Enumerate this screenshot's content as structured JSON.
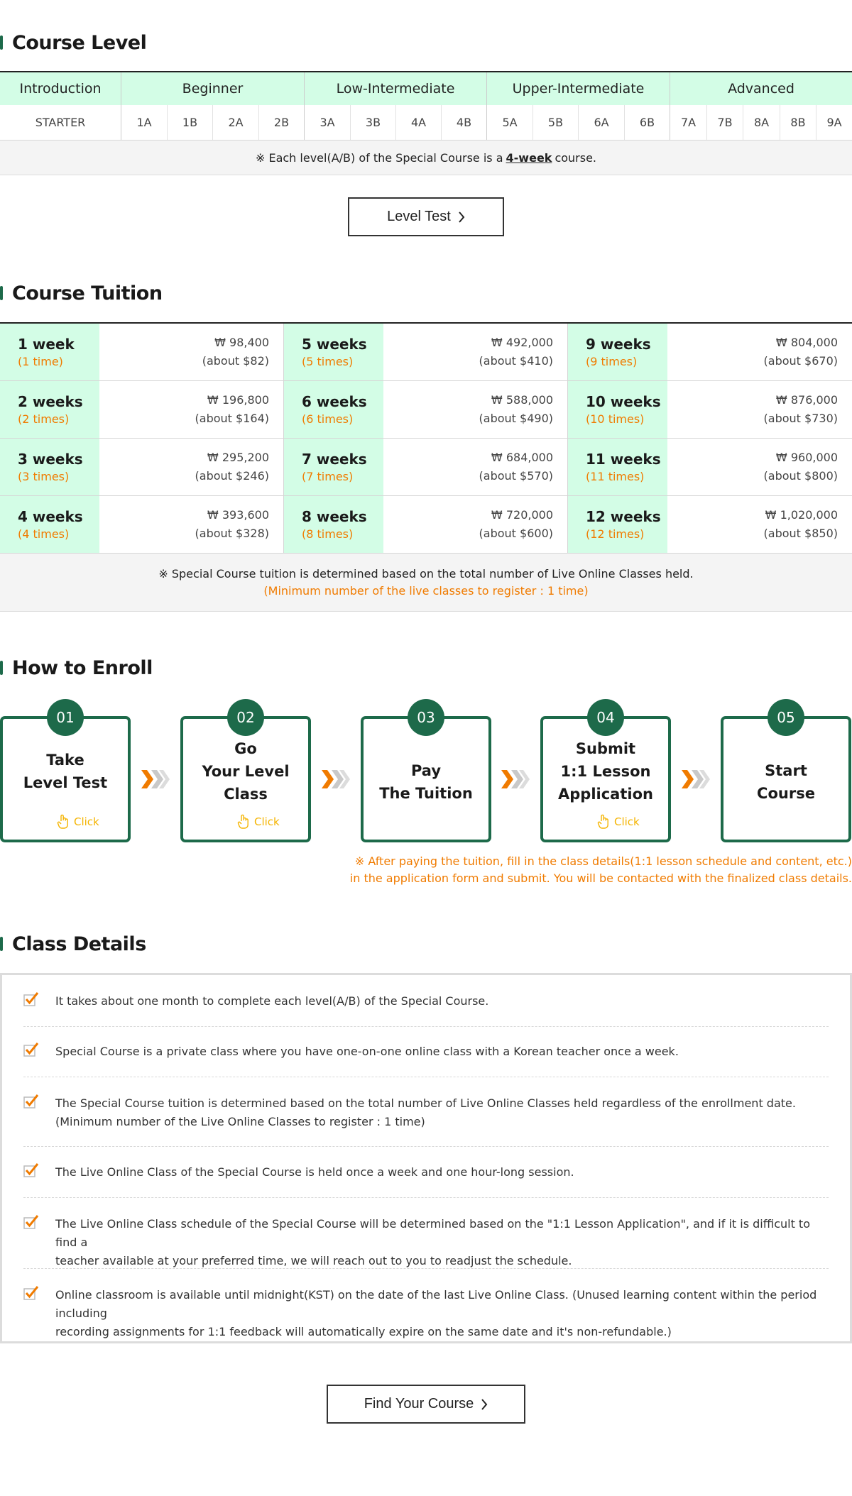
{
  "course_level": {
    "title": "Course Level",
    "groups": [
      "Introduction",
      "Beginner",
      "Low-Intermediate",
      "Upper-Intermediate",
      "Advanced"
    ],
    "levels": [
      "STARTER",
      "1A",
      "1B",
      "2A",
      "2B",
      "3A",
      "3B",
      "4A",
      "4B",
      "5A",
      "5B",
      "6A",
      "6B",
      "7A",
      "7B",
      "8A",
      "8B",
      "9A"
    ],
    "note_prefix": "※ Each level(A/B) of the Special Course is a",
    "note_emphasis": "4-week",
    "note_suffix": "course.",
    "level_test_button": "Level Test"
  },
  "course_tuition": {
    "title": "Course Tuition",
    "rows": [
      [
        {
          "weeks": "1 week",
          "times": "(1 time)",
          "price": "₩ 98,400",
          "usd": "(about $82)"
        },
        {
          "weeks": "5 weeks",
          "times": "(5 times)",
          "price": "₩ 492,000",
          "usd": "(about $410)"
        },
        {
          "weeks": "9 weeks",
          "times": "(9 times)",
          "price": "₩ 804,000",
          "usd": "(about $670)"
        }
      ],
      [
        {
          "weeks": "2 weeks",
          "times": "(2 times)",
          "price": "₩ 196,800",
          "usd": "(about $164)"
        },
        {
          "weeks": "6 weeks",
          "times": "(6 times)",
          "price": "₩ 588,000",
          "usd": "(about $490)"
        },
        {
          "weeks": "10 weeks",
          "times": "(10 times)",
          "price": "₩ 876,000",
          "usd": "(about $730)"
        }
      ],
      [
        {
          "weeks": "3 weeks",
          "times": "(3 times)",
          "price": "₩ 295,200",
          "usd": "(about $246)"
        },
        {
          "weeks": "7 weeks",
          "times": "(7 times)",
          "price": "₩ 684,000",
          "usd": "(about $570)"
        },
        {
          "weeks": "11 weeks",
          "times": "(11 times)",
          "price": "₩ 960,000",
          "usd": "(about $800)"
        }
      ],
      [
        {
          "weeks": "4 weeks",
          "times": "(4 times)",
          "price": "₩ 393,600",
          "usd": "(about $328)"
        },
        {
          "weeks": "8 weeks",
          "times": "(8 times)",
          "price": "₩ 720,000",
          "usd": "(about $600)"
        },
        {
          "weeks": "12 weeks",
          "times": "(12 times)",
          "price": "₩ 1,020,000",
          "usd": "(about $850)"
        }
      ]
    ],
    "note_line1": "※ Special Course tuition is determined based on the total number of Live Online Classes held.",
    "note_line2": "(Minimum number of the live classes to register : 1 time)"
  },
  "how_to_enroll": {
    "title": "How to Enroll",
    "steps": [
      {
        "num": "01",
        "line1": "Take",
        "line2": "Level Test",
        "line3": "",
        "click": "Click"
      },
      {
        "num": "02",
        "line1": "Go",
        "line2": "Your Level Class",
        "line3": "",
        "click": "Click"
      },
      {
        "num": "03",
        "line1": "Pay",
        "line2": "The Tuition",
        "line3": "",
        "click": ""
      },
      {
        "num": "04",
        "line1": "Submit",
        "line2": "1:1 Lesson",
        "line3": "Application",
        "click": "Click"
      },
      {
        "num": "05",
        "line1": "Start",
        "line2": "Course",
        "line3": "",
        "click": ""
      }
    ],
    "note_line1": "※ After paying the tuition, fill in the class details(1:1 lesson schedule and content, etc.)",
    "note_line2": "in the application form and submit. You will be contacted with the finalized class details."
  },
  "class_details": {
    "title": "Class Details",
    "items": [
      {
        "line1": "It takes about one month to complete each level(A/B) of the Special Course.",
        "line2": ""
      },
      {
        "line1": "Special Course is a private class where you have one-on-one online class with a Korean teacher once a week.",
        "line2": ""
      },
      {
        "line1": "The Special Course tuition is determined based on the total number of Live Online Classes held regardless of the enrollment date.",
        "line2": "(Minimum number of the Live Online Classes to register : 1 time)"
      },
      {
        "line1": "The Live Online Class of the Special Course is held once a week and one hour-long session.",
        "line2": ""
      },
      {
        "line1": "The Live Online Class schedule of the Special Course will be determined based on the \"1:1 Lesson Application\", and if it is difficult to find a",
        "line2": "teacher available at your preferred time, we will reach out to you to readjust the schedule."
      },
      {
        "line1": "Online classroom is available until midnight(KST) on the date of the last Live Online Class. (Unused learning content within the period including",
        "line2": "recording assignments for 1:1 feedback will automatically expire on the same date and it's non-refundable.)"
      }
    ],
    "find_button": "Find Your Course"
  },
  "colors": {
    "accent_green": "#1d6a4a",
    "mint": "#d3fde6",
    "orange": "#f07b00",
    "yellow": "#f5b400"
  },
  "icons": {
    "section_marker": "green-bar-icon",
    "chevron": "chevron-right-icon",
    "arrow": "double-chevron-arrow-icon",
    "click": "pointing-hand-icon",
    "check": "checkbox-check-icon"
  }
}
